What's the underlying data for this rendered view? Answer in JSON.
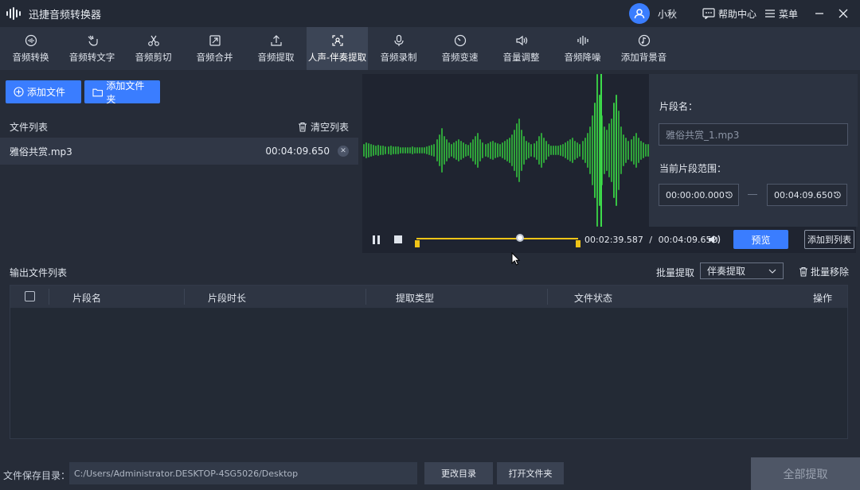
{
  "app": {
    "title": "迅捷音频转换器"
  },
  "user": {
    "name": "小秋"
  },
  "titlebar": {
    "help": "帮助中心",
    "menu": "菜单"
  },
  "tools": [
    {
      "label": "音频转换",
      "icon": "convert-icon"
    },
    {
      "label": "音频转文字",
      "icon": "hand-text-icon"
    },
    {
      "label": "音频剪切",
      "icon": "scissors-icon"
    },
    {
      "label": "音频合并",
      "icon": "merge-icon"
    },
    {
      "label": "音频提取",
      "icon": "upload-icon"
    },
    {
      "label": "人声-伴奏提取",
      "icon": "vocal-extract-icon",
      "active": true
    },
    {
      "label": "音频录制",
      "icon": "mic-icon"
    },
    {
      "label": "音频变速",
      "icon": "speed-icon"
    },
    {
      "label": "音量调整",
      "icon": "volume-icon"
    },
    {
      "label": "音频降噪",
      "icon": "denoise-icon"
    },
    {
      "label": "添加背景音",
      "icon": "music-note-icon"
    }
  ],
  "left": {
    "add_file": "添加文件",
    "add_folder": "添加文件夹",
    "file_list_title": "文件列表",
    "clear_list": "清空列表",
    "files": [
      {
        "name": "雅俗共赏.mp3",
        "duration": "00:04:09.650"
      }
    ]
  },
  "player": {
    "current_time": "00:02:39.587",
    "separator": "/",
    "total_time": "00:04:09.652",
    "progress": 0.64,
    "preview": "预览",
    "add_to_list": "添加到列表"
  },
  "segment": {
    "name_label": "片段名：",
    "name_placeholder": "雅俗共赏_1.mp3",
    "range_label": "当前片段范围：",
    "start": "00:00:00.000",
    "end": "00:04:09.650"
  },
  "output": {
    "title": "输出文件列表",
    "batch_label": "批量提取",
    "batch_value": "伴奏提取",
    "batch_remove": "批量移除",
    "columns": [
      "片段名",
      "片段时长",
      "提取类型",
      "文件状态",
      "操作"
    ]
  },
  "bottom": {
    "save_label": "文件保存目录：",
    "path": "C:/Users/Administrator.DESKTOP-4SG5026/Desktop",
    "change_dir": "更改目录",
    "open_folder": "打开文件夹",
    "extract_all": "全部提取"
  },
  "colors": {
    "accent": "#3a7dff",
    "wave": "#2fa33a",
    "range": "#f0c417"
  }
}
